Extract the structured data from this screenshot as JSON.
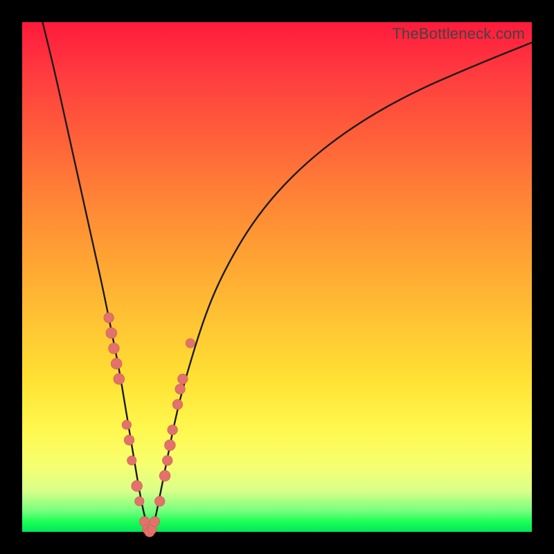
{
  "watermark": "TheBottleneck.com",
  "colors": {
    "frame": "#000000",
    "curve_stroke": "#1a1a1a",
    "marker_fill": "#e2726b",
    "marker_stroke": "#d45f58"
  },
  "chart_data": {
    "type": "line",
    "title": "",
    "xlabel": "",
    "ylabel": "",
    "xlim": [
      0,
      100
    ],
    "ylim": [
      0,
      100
    ],
    "grid": false,
    "legend": false,
    "series": [
      {
        "name": "bottleneck-curve",
        "x": [
          4,
          6,
          8,
          10,
          12,
          14,
          16,
          18,
          19,
          20,
          21,
          22,
          23,
          24,
          25,
          26,
          27,
          28,
          30,
          32,
          36,
          40,
          46,
          54,
          64,
          76,
          90,
          100
        ],
        "y": [
          100,
          92,
          83,
          74,
          65,
          56,
          47,
          37,
          32,
          26,
          20,
          14,
          8,
          3,
          0,
          2,
          7,
          12,
          22,
          30,
          43,
          52,
          62,
          71,
          79,
          86,
          92,
          96
        ]
      }
    ],
    "markers": [
      {
        "x": 17.0,
        "y": 42,
        "r": 1.2
      },
      {
        "x": 17.5,
        "y": 39,
        "r": 1.3
      },
      {
        "x": 18.0,
        "y": 36,
        "r": 1.3
      },
      {
        "x": 18.5,
        "y": 33,
        "r": 1.3
      },
      {
        "x": 19.0,
        "y": 30,
        "r": 1.3
      },
      {
        "x": 20.5,
        "y": 21,
        "r": 1.1
      },
      {
        "x": 21.0,
        "y": 18,
        "r": 1.2
      },
      {
        "x": 21.5,
        "y": 14,
        "r": 1.1
      },
      {
        "x": 22.5,
        "y": 9,
        "r": 1.3
      },
      {
        "x": 23.0,
        "y": 6,
        "r": 1.1
      },
      {
        "x": 24.0,
        "y": 2,
        "r": 1.2
      },
      {
        "x": 24.5,
        "y": 0.5,
        "r": 1.1
      },
      {
        "x": 25.0,
        "y": 0,
        "r": 1.2
      },
      {
        "x": 25.5,
        "y": 0.5,
        "r": 1.1
      },
      {
        "x": 26.0,
        "y": 2,
        "r": 1.2
      },
      {
        "x": 27.0,
        "y": 6,
        "r": 1.2
      },
      {
        "x": 28.0,
        "y": 11,
        "r": 1.3
      },
      {
        "x": 28.5,
        "y": 14,
        "r": 1.2
      },
      {
        "x": 29.0,
        "y": 17,
        "r": 1.3
      },
      {
        "x": 29.5,
        "y": 20,
        "r": 1.2
      },
      {
        "x": 30.5,
        "y": 25,
        "r": 1.2
      },
      {
        "x": 31.0,
        "y": 28,
        "r": 1.2
      },
      {
        "x": 31.5,
        "y": 30,
        "r": 1.2
      },
      {
        "x": 33.0,
        "y": 37,
        "r": 1.1
      }
    ]
  }
}
